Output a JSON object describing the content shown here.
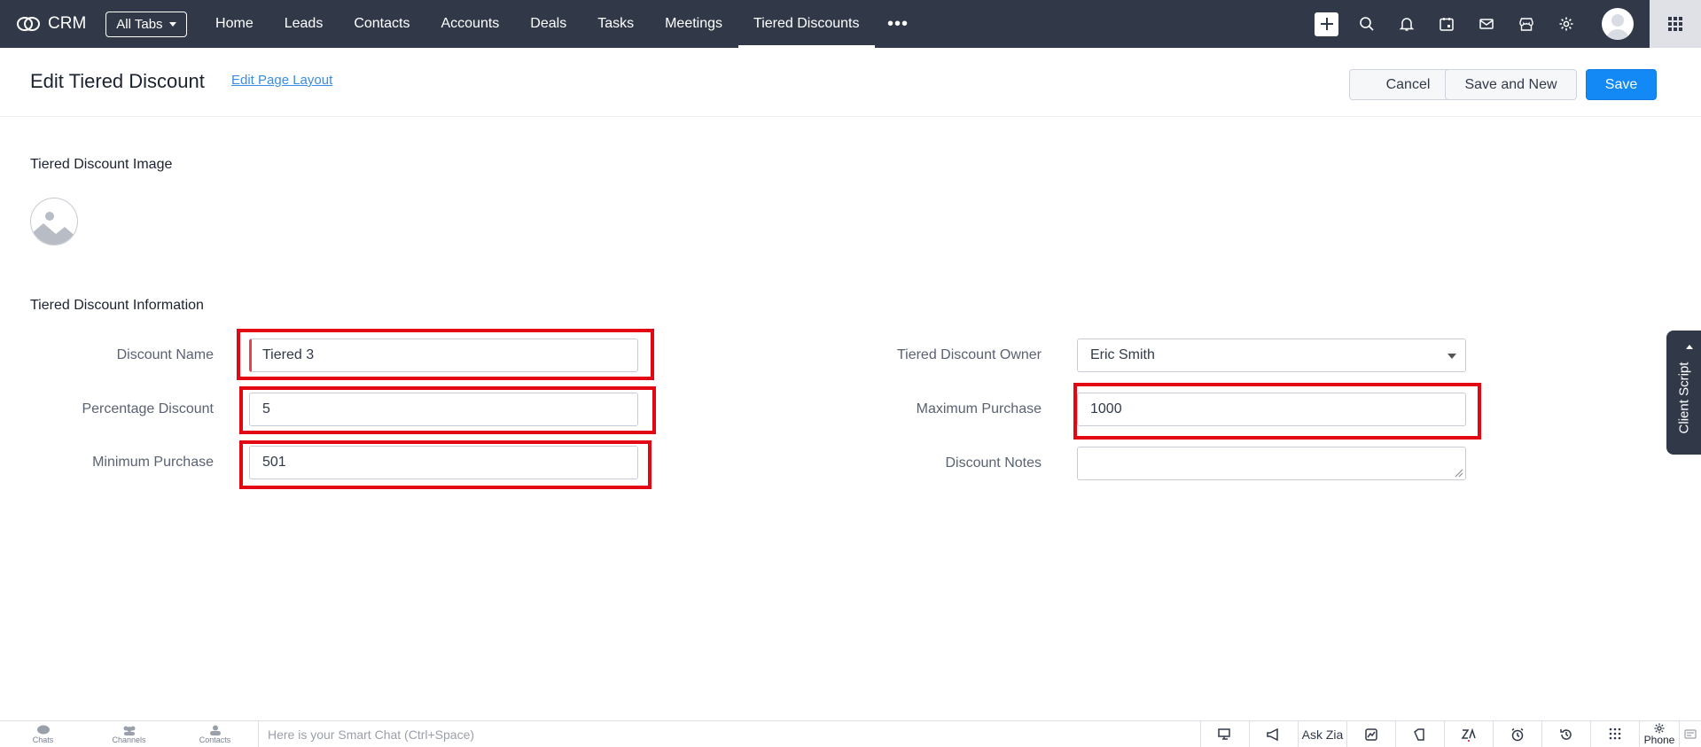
{
  "app": {
    "name": "CRM",
    "all_tabs_label": "All Tabs"
  },
  "nav": {
    "tabs": [
      {
        "label": "Home"
      },
      {
        "label": "Leads"
      },
      {
        "label": "Contacts"
      },
      {
        "label": "Accounts"
      },
      {
        "label": "Deals"
      },
      {
        "label": "Tasks"
      },
      {
        "label": "Meetings"
      },
      {
        "label": "Tiered Discounts",
        "active": true
      }
    ],
    "more_label": "•••"
  },
  "page": {
    "title": "Edit Tiered Discount",
    "edit_layout_link": "Edit Page Layout",
    "cancel_label": "Cancel",
    "save_new_label": "Save and New",
    "save_label": "Save"
  },
  "sections": {
    "image_title": "Tiered Discount Image",
    "info_title": "Tiered Discount Information"
  },
  "form": {
    "discount_name": {
      "label": "Discount Name",
      "value": "Tiered 3"
    },
    "percentage_discount": {
      "label": "Percentage Discount",
      "value": "5"
    },
    "minimum_purchase": {
      "label": "Minimum Purchase",
      "value": "501"
    },
    "owner": {
      "label": "Tiered Discount Owner",
      "value": "Eric Smith"
    },
    "maximum_purchase": {
      "label": "Maximum Purchase",
      "value": "1000"
    },
    "discount_notes": {
      "label": "Discount Notes",
      "value": ""
    }
  },
  "client_script_label": "Client Script",
  "bottom_bar": {
    "chats": "Chats",
    "channels": "Channels",
    "contacts": "Contacts",
    "smart_chat_placeholder": "Here is your Smart Chat (Ctrl+Space)",
    "ask_zia": "Ask Zia",
    "phone": "Phone"
  },
  "colors": {
    "topbar": "#313949",
    "primary": "#1289f5",
    "highlight": "#e30613",
    "mandatory": "#e8414b"
  }
}
